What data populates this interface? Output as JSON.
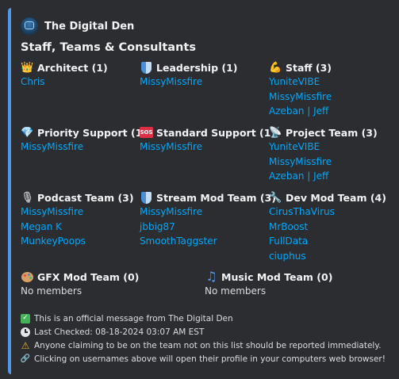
{
  "author": {
    "name": "The Digital Den",
    "avatar_icon": "digital-den-logo"
  },
  "title": "Staff, Teams & Consultants",
  "accent_color": "#4e97e9",
  "link_color": "#00a8fc",
  "fields": [
    {
      "emoji": "👑",
      "icon": "crown-icon",
      "name": "Architect (1)",
      "members": [
        "Chris"
      ]
    },
    {
      "emoji": "",
      "icon": "shield-icon",
      "name": "Leadership (1)",
      "members": [
        "MissyMissfire"
      ]
    },
    {
      "emoji": "💪",
      "icon": "flexed-biceps-icon",
      "name": "Staff (3)",
      "members": [
        "YuniteVIBE",
        "MissyMissfire",
        "Azeban | Jeff"
      ]
    },
    {
      "emoji": "💎",
      "icon": "gem-icon",
      "name": "Priority Support (1)",
      "members": [
        "MissyMissfire"
      ]
    },
    {
      "emoji": "SOS",
      "icon": "sos-icon",
      "name": "Standard Support (1)",
      "members": [
        "MissyMissfire"
      ]
    },
    {
      "emoji": "📡",
      "icon": "satellite-dish-icon",
      "name": "Project Team (3)",
      "members": [
        "YuniteVIBE",
        "MissyMissfire",
        "Azeban | Jeff"
      ]
    },
    {
      "emoji": "🎙",
      "icon": "microphone-icon",
      "name": "Podcast Team (3)",
      "members": [
        "MissyMissfire",
        "Megan K",
        "MunkeyPoops"
      ]
    },
    {
      "emoji": "",
      "icon": "shield-icon",
      "name": "Stream Mod Team (3)",
      "members": [
        "MissyMissfire",
        "jbbig87",
        "SmoothTaggster"
      ]
    },
    {
      "emoji": "🔧",
      "icon": "wrench-icon",
      "name": "Dev Mod Team (4)",
      "members": [
        "CirusThaVirus",
        "MrBoost",
        "FullData",
        "ciuphus"
      ]
    },
    {
      "emoji": "",
      "icon": "palette-icon",
      "name": "GFX Mod Team (0)",
      "empty_text": "No members"
    },
    {
      "emoji": "♫",
      "icon": "musical-notes-icon",
      "name": "Music Mod Team (0)",
      "empty_text": "No members"
    }
  ],
  "footer": [
    {
      "emoji": "✓",
      "icon": "check-mark-icon",
      "text": "This is an official message from The Digital Den"
    },
    {
      "emoji": "",
      "icon": "clock-icon",
      "text": "Last Checked: 08-18-2024 03:07 AM EST"
    },
    {
      "emoji": "⚠",
      "icon": "warning-icon",
      "text": "Anyone claiming to be on the team not on this list should be reported immediately."
    },
    {
      "emoji": "🔗",
      "icon": "link-icon",
      "text": "Clicking on usernames above will open their profile in your computers web browser!"
    }
  ]
}
